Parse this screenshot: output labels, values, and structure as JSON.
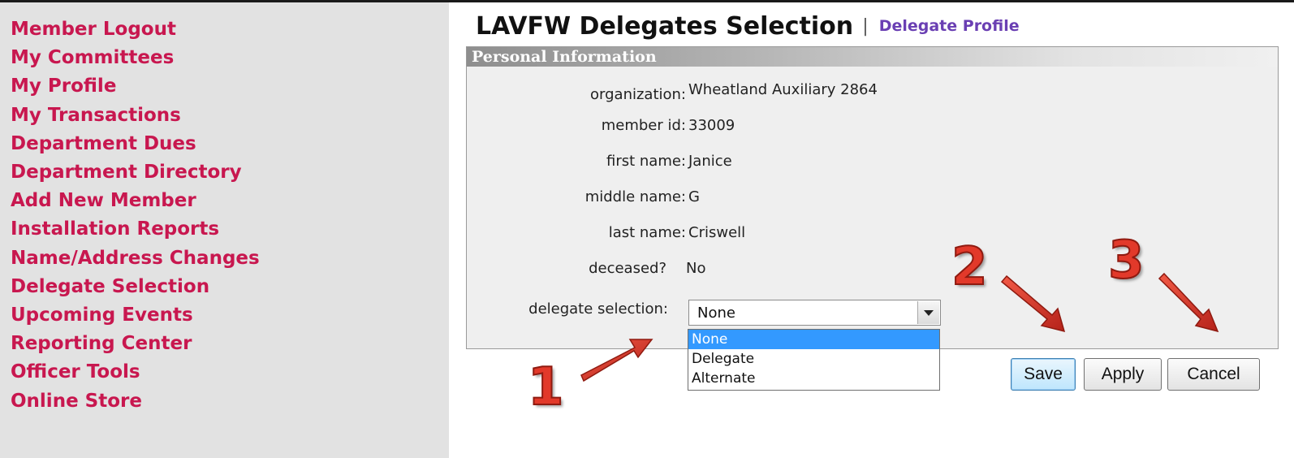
{
  "sidebar": {
    "items": [
      "Member Logout",
      "My Committees",
      "My Profile",
      "My Transactions",
      "Department Dues",
      "Department Directory",
      "Add New Member",
      "Installation Reports",
      "Name/Address Changes",
      "Delegate Selection",
      "Upcoming Events",
      "Reporting Center",
      "Officer Tools",
      "Online Store"
    ]
  },
  "header": {
    "title": "LAVFW Delegates Selection",
    "separator": "|",
    "subtitle": "Delegate Profile"
  },
  "panel": {
    "title": "Personal Information",
    "fields": [
      {
        "label": "organization:",
        "value": "Wheatland Auxiliary 2864"
      },
      {
        "label": "member id:",
        "value": "33009"
      },
      {
        "label": "first name:",
        "value": "Janice"
      },
      {
        "label": "middle name:",
        "value": "G"
      },
      {
        "label": "last name:",
        "value": "Criswell"
      },
      {
        "label": "deceased?",
        "value": "No"
      }
    ],
    "delegate_label": "delegate selection:",
    "delegate_selected": "None",
    "delegate_options": [
      "None",
      "Delegate",
      "Alternate"
    ]
  },
  "buttons": {
    "save": "Save",
    "apply": "Apply",
    "cancel": "Cancel"
  },
  "annotations": {
    "marks": [
      "1",
      "2",
      "3"
    ],
    "color": "#e2392a"
  },
  "colors": {
    "sidebar_link": "#c8174f",
    "subtitle_link": "#6a3fb3",
    "selected_option": "#3399ff"
  }
}
